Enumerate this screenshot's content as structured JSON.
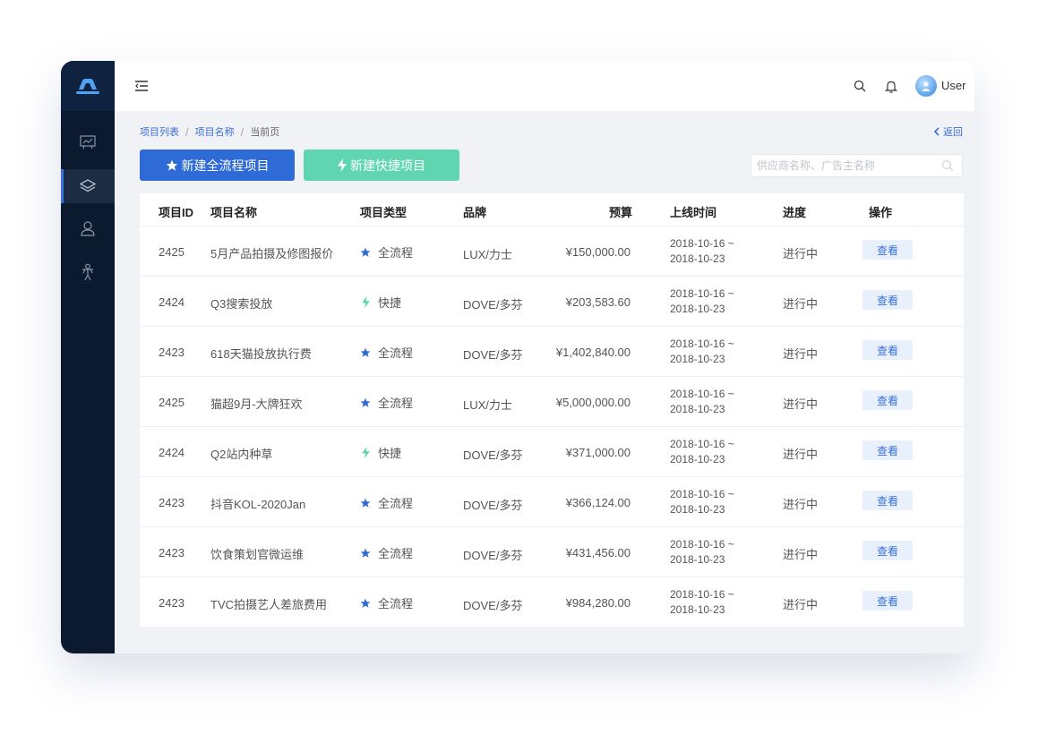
{
  "header": {
    "username": "User"
  },
  "breadcrumb": {
    "items": [
      "项目列表",
      "项目名称",
      "当前页"
    ],
    "back_label": "返回"
  },
  "actions": {
    "new_full_label": "新建全流程项目",
    "new_quick_label": "新建快捷项目"
  },
  "search": {
    "placeholder": "供应商名称、广告主名称",
    "value": ""
  },
  "table": {
    "columns": [
      "项目ID",
      "项目名称",
      "项目类型",
      "品牌",
      "预算",
      "上线时间",
      "进度",
      "操作"
    ],
    "rows": [
      {
        "id": "2425",
        "name": "5月产品拍摄及修图报价",
        "type_icon": "star-icon",
        "type": "全流程",
        "brand": "LUX/力士",
        "budget": "¥150,000.00",
        "date_start": "2018-10-16 ~",
        "date_end": "2018-10-23",
        "status": "进行中",
        "action": "查看"
      },
      {
        "id": "2424",
        "name": "Q3搜索投放",
        "type_icon": "bolt-icon",
        "type": "快捷",
        "brand": "DOVE/多芬",
        "budget": "¥203,583.60",
        "date_start": "2018-10-16 ~",
        "date_end": "2018-10-23",
        "status": "进行中",
        "action": "查看"
      },
      {
        "id": "2423",
        "name": "618天猫投放执行费",
        "type_icon": "star-icon",
        "type": "全流程",
        "brand": "DOVE/多芬",
        "budget": "¥1,402,840.00",
        "date_start": "2018-10-16 ~",
        "date_end": "2018-10-23",
        "status": "进行中",
        "action": "查看"
      },
      {
        "id": "2425",
        "name": "猫超9月-大牌狂欢",
        "type_icon": "star-icon",
        "type": "全流程",
        "brand": "LUX/力士",
        "budget": "¥5,000,000.00",
        "date_start": "2018-10-16 ~",
        "date_end": "2018-10-23",
        "status": "进行中",
        "action": "查看"
      },
      {
        "id": "2424",
        "name": "Q2站内种草",
        "type_icon": "bolt-icon",
        "type": "快捷",
        "brand": "DOVE/多芬",
        "budget": "¥371,000.00",
        "date_start": "2018-10-16 ~",
        "date_end": "2018-10-23",
        "status": "进行中",
        "action": "查看"
      },
      {
        "id": "2423",
        "name": "抖音KOL-2020Jan",
        "type_icon": "star-icon",
        "type": "全流程",
        "brand": "DOVE/多芬",
        "budget": "¥366,124.00",
        "date_start": "2018-10-16 ~",
        "date_end": "2018-10-23",
        "status": "进行中",
        "action": "查看"
      },
      {
        "id": "2423",
        "name": "饮食策划官微运维",
        "type_icon": "star-icon",
        "type": "全流程",
        "brand": "DOVE/多芬",
        "budget": "¥431,456.00",
        "date_start": "2018-10-16 ~",
        "date_end": "2018-10-23",
        "status": "进行中",
        "action": "查看"
      },
      {
        "id": "2423",
        "name": "TVC拍摄艺人差旅费用",
        "type_icon": "star-icon",
        "type": "全流程",
        "brand": "DOVE/多芬",
        "budget": "¥984,280.00",
        "date_start": "2018-10-16 ~",
        "date_end": "2018-10-23",
        "status": "进行中",
        "action": "查看"
      }
    ]
  },
  "colors": {
    "primary": "#2f6bd6",
    "quick": "#5fd6b0",
    "sidebar": "#0b1a2e",
    "link": "#3a6fd8"
  }
}
